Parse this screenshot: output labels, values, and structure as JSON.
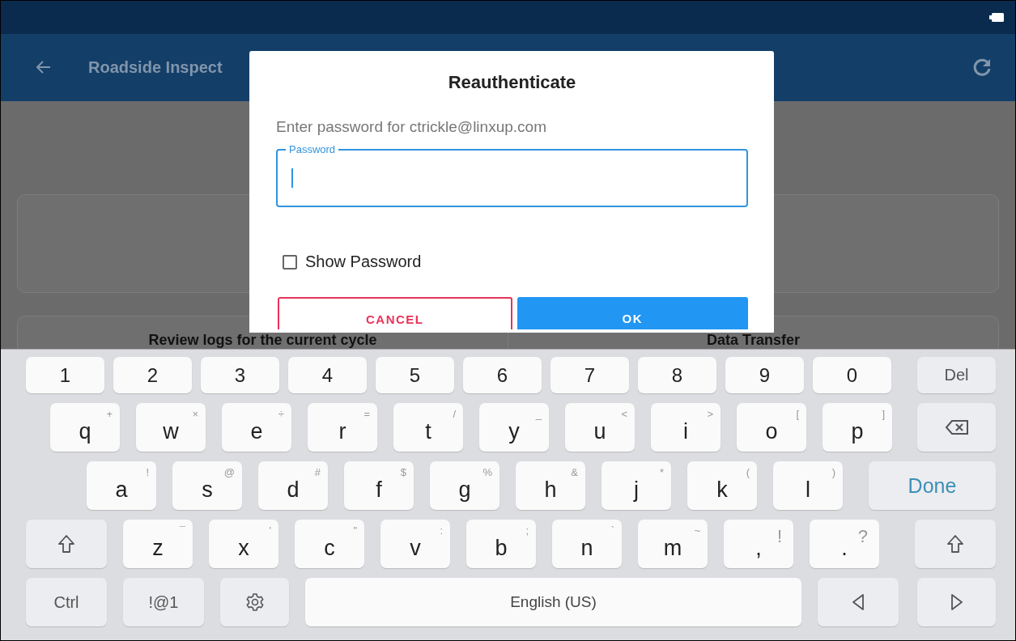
{
  "app_bar": {
    "title": "Roadside Inspect"
  },
  "content": {
    "card_texts": [
      "Review logs for the current cycle",
      "Data Transfer"
    ]
  },
  "dialog": {
    "title": "Reauthenticate",
    "message": "Enter password for ctrickle@linxup.com",
    "password_field": {
      "label": "Password",
      "focused": true
    },
    "show_password": {
      "label": "Show Password",
      "checked": false
    },
    "buttons": [
      {
        "label": "CANCEL",
        "kind": "outline"
      },
      {
        "label": "OK",
        "kind": "filled"
      }
    ]
  },
  "keyboard": {
    "rows": [
      [
        {
          "label": "1",
          "kind": "digit"
        },
        {
          "label": "2",
          "kind": "digit"
        },
        {
          "label": "3",
          "kind": "digit"
        },
        {
          "label": "4",
          "kind": "digit"
        },
        {
          "label": "5",
          "kind": "digit"
        },
        {
          "label": "6",
          "kind": "digit"
        },
        {
          "label": "7",
          "kind": "digit"
        },
        {
          "label": "8",
          "kind": "digit"
        },
        {
          "label": "9",
          "kind": "digit"
        },
        {
          "label": "0",
          "kind": "digit"
        },
        {
          "label": "Del",
          "kind": "func"
        }
      ],
      [
        {
          "label": "q",
          "hint": "+",
          "kind": "char"
        },
        {
          "label": "w",
          "hint": "×",
          "kind": "char"
        },
        {
          "label": "e",
          "hint": "÷",
          "kind": "char"
        },
        {
          "label": "r",
          "hint": "=",
          "kind": "char"
        },
        {
          "label": "t",
          "hint": "/",
          "kind": "char"
        },
        {
          "label": "y",
          "hint": "_",
          "kind": "char"
        },
        {
          "label": "u",
          "hint": "<",
          "kind": "char"
        },
        {
          "label": "i",
          "hint": ">",
          "kind": "char"
        },
        {
          "label": "o",
          "hint": "[",
          "kind": "char"
        },
        {
          "label": "p",
          "hint": "]",
          "kind": "char"
        },
        {
          "kind": "backspace"
        }
      ],
      [
        {
          "label": "a",
          "hint": "!",
          "kind": "char"
        },
        {
          "label": "s",
          "hint": "@",
          "kind": "char"
        },
        {
          "label": "d",
          "hint": "#",
          "kind": "char"
        },
        {
          "label": "f",
          "hint": "$",
          "kind": "char"
        },
        {
          "label": "g",
          "hint": "%",
          "kind": "char"
        },
        {
          "label": "h",
          "hint": "&",
          "kind": "char"
        },
        {
          "label": "j",
          "hint": "*",
          "kind": "char"
        },
        {
          "label": "k",
          "hint": "(",
          "kind": "char"
        },
        {
          "label": "l",
          "hint": ")",
          "kind": "char"
        },
        {
          "label": "Done",
          "kind": "action"
        }
      ],
      [
        {
          "kind": "shift"
        },
        {
          "label": "z",
          "hint": "¯",
          "kind": "char"
        },
        {
          "label": "x",
          "hint": "'",
          "kind": "char"
        },
        {
          "label": "c",
          "hint": "\"",
          "kind": "char"
        },
        {
          "label": "v",
          "hint": ":",
          "kind": "char"
        },
        {
          "label": "b",
          "hint": ";",
          "kind": "char"
        },
        {
          "label": "n",
          "hint": "`",
          "kind": "char"
        },
        {
          "label": "m",
          "hint": "~",
          "kind": "char"
        },
        {
          "label": ",",
          "hint": "!",
          "kind": "punct"
        },
        {
          "label": ".",
          "hint": "?",
          "kind": "punct"
        },
        {
          "kind": "shift"
        }
      ],
      [
        {
          "label": "Ctrl",
          "kind": "func"
        },
        {
          "label": "!@1",
          "kind": "func"
        },
        {
          "kind": "settings"
        },
        {
          "label": "English (US)",
          "kind": "space"
        },
        {
          "kind": "left"
        },
        {
          "kind": "right"
        }
      ]
    ]
  }
}
